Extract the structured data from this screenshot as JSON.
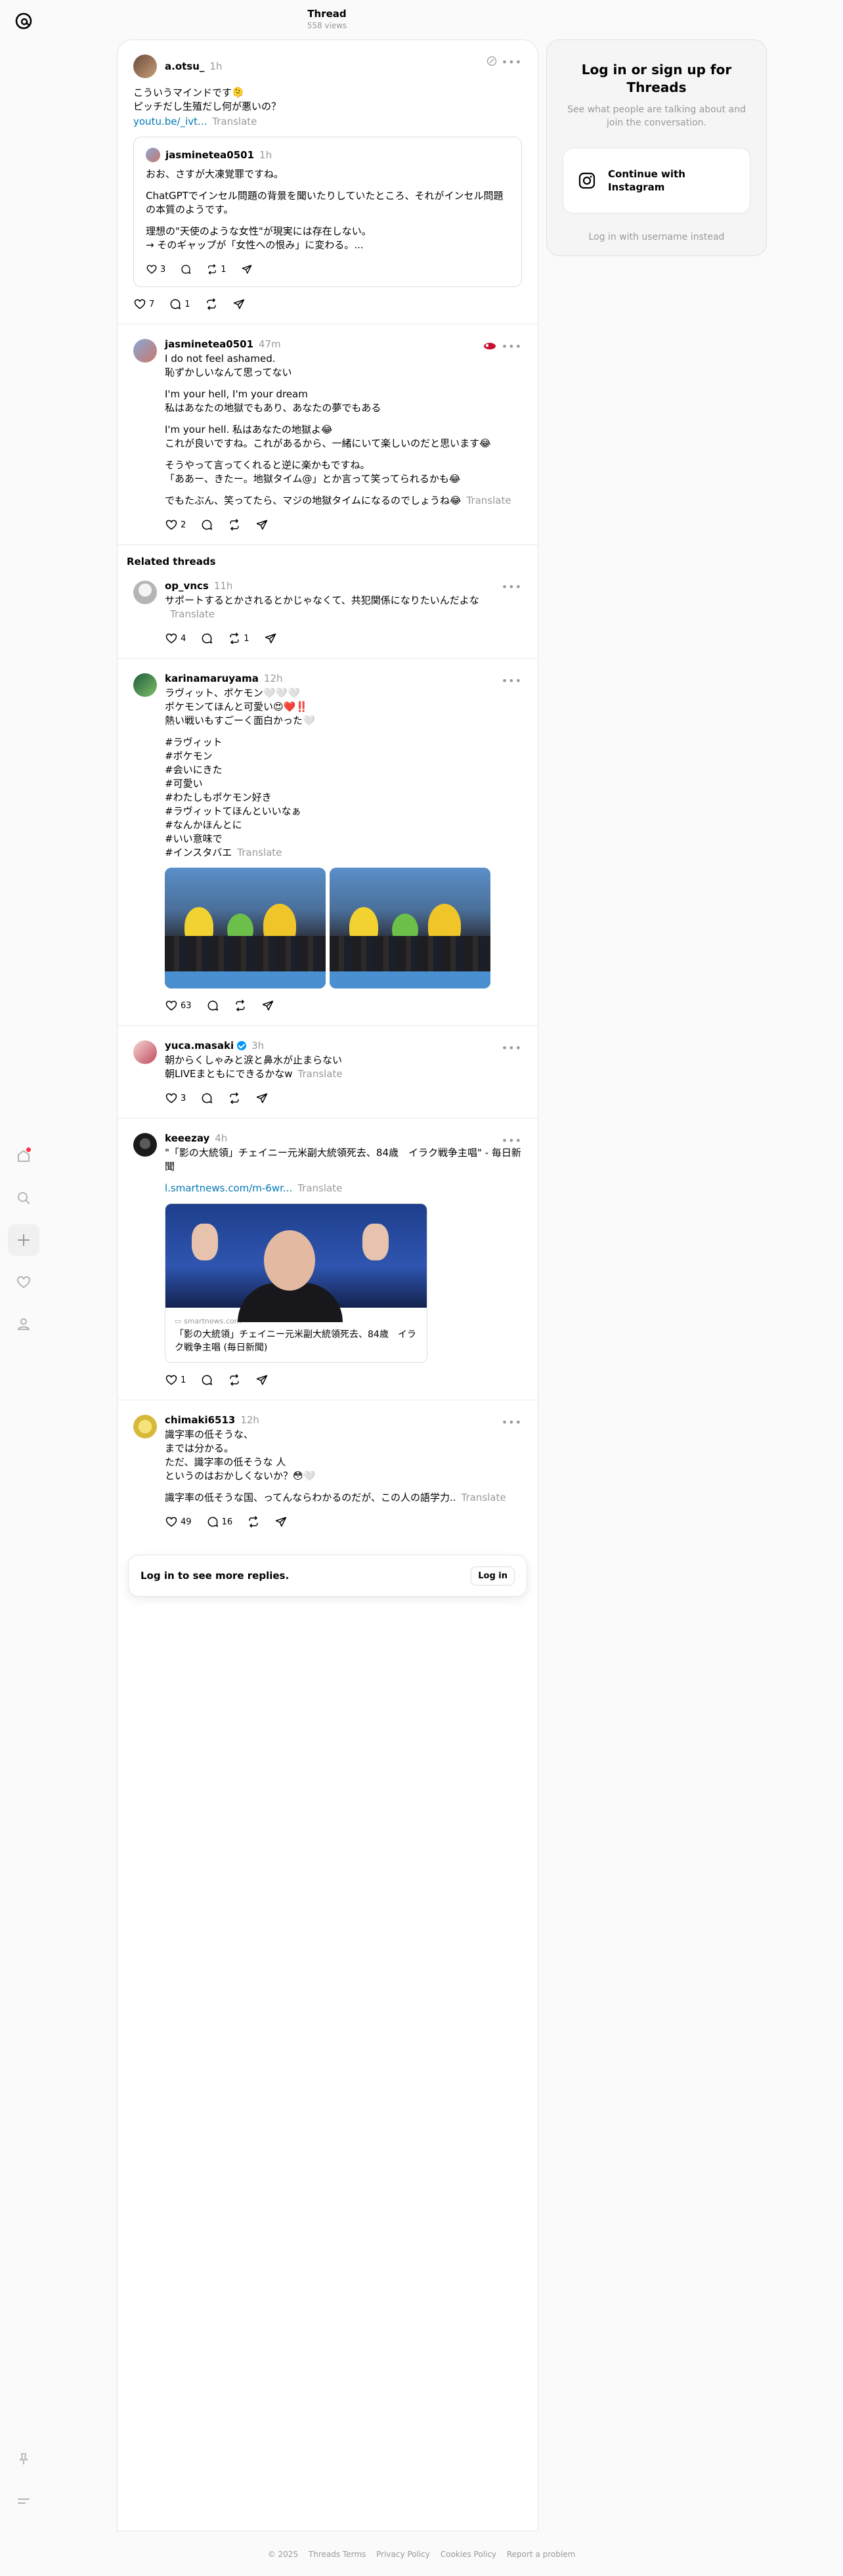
{
  "header": {
    "title": "Thread",
    "views": "558 views"
  },
  "main_post": {
    "user": "a.otsu_",
    "time": "1h",
    "text": "こういうマインドです🫠\nピッチだし生殖だし何が悪いの？",
    "link": "youtu.be/_ivt...",
    "translate": "Translate",
    "quote": {
      "user": "jasminetea0501",
      "time": "1h",
      "p1": "おお、さすが大凍覚罪ですね。",
      "p2": "ChatGPTでインセル問題の背景を聞いたりしていたところ、それがインセル問題の本質のようです。",
      "p3": "理想の\"天使のような女性\"が現実には存在しない。\n→ そのギャップが「女性への恨み」に変わる。...",
      "likes": "3",
      "replies": "",
      "reposts": "1"
    },
    "likes": "7",
    "replies": "1"
  },
  "reply_post": {
    "user": "jasminetea0501",
    "time": "47m",
    "p1": "I do not feel ashamed.\n恥ずかしいなんて思ってない",
    "p2": "I'm your hell, I'm your dream\n私はあなたの地獄でもあり、あなたの夢でもある",
    "p3": "I'm your hell. 私はあなたの地獄よ😂\nこれが良いですね。これがあるから、一緒にいて楽しいのだと思います😂",
    "p4": "そうやって言ってくれると逆に楽かもですね。\n「ああー、きたー。地獄タイム@」とか言って笑ってられるかも😂",
    "p5": "でもたぶん、笑ってたら、マジの地獄タイムになるのでしょうね😂",
    "translate": "Translate",
    "likes": "2"
  },
  "related_label": "Related threads",
  "related": [
    {
      "user": "op_vncs",
      "time": "11h",
      "text": "サポートするとかされるとかじゃなくて、共犯関係になりたいんだよな",
      "translate": "Translate",
      "likes": "4",
      "reposts": "1"
    },
    {
      "user": "karinamaruyama",
      "time": "12h",
      "p1": "ラヴィット、ポケモン🤍🤍🤍\nポケモンてほんと可愛い😍❤️‼️\n熱い戦いもすごーく面白かった🤍",
      "p2": "#ラヴィット\n#ポケモン\n#会いにきた\n#可愛い\n#わたしもポケモン好き\n#ラヴィットてほんといいなぁ\n#なんかほんとに\n#いい意味で\n#インスタバエ",
      "translate": "Translate",
      "likes": "63"
    },
    {
      "user": "yuca.masaki",
      "time": "3h",
      "text": "朝からくしゃみと涙と鼻水が止まらない\n朝LIVEまともにできるかなw",
      "translate": "Translate",
      "likes": "3"
    },
    {
      "user": "keeezay",
      "time": "4h",
      "text": "\"「影の大統領」チェイニー元米副大統領死去、84歳　イラク戦争主唱\" - 毎日新聞",
      "link": "l.smartnews.com/m-6wr...",
      "translate": "Translate",
      "card_domain": "smartnews.com",
      "card_title": "「影の大統領」チェイニー元米副大統領死去、84歳　イラク戦争主唱 (毎日新聞)",
      "likes": "1"
    },
    {
      "user": "chimaki6513",
      "time": "12h",
      "p1": "識字率の低そうな、\nまでは分かる。\nただ、識字率の低そうな 人\nというのはおかしくないか？😳🤍",
      "p2": "識字率の低そうな国、ってんならわかるのだが、この人の語学力..",
      "translate": "Translate",
      "likes": "49",
      "replies": "16"
    }
  ],
  "login_more": {
    "text": "Log in to see more replies.",
    "button": "Log in"
  },
  "panel": {
    "title": "Log in or sign up for Threads",
    "desc": "See what people are talking about and join the conversation.",
    "instagram": "Continue with Instagram",
    "alt": "Log in with username instead"
  },
  "footer": [
    "© 2025",
    "Threads Terms",
    "Privacy Policy",
    "Cookies Policy",
    "Report a problem"
  ]
}
